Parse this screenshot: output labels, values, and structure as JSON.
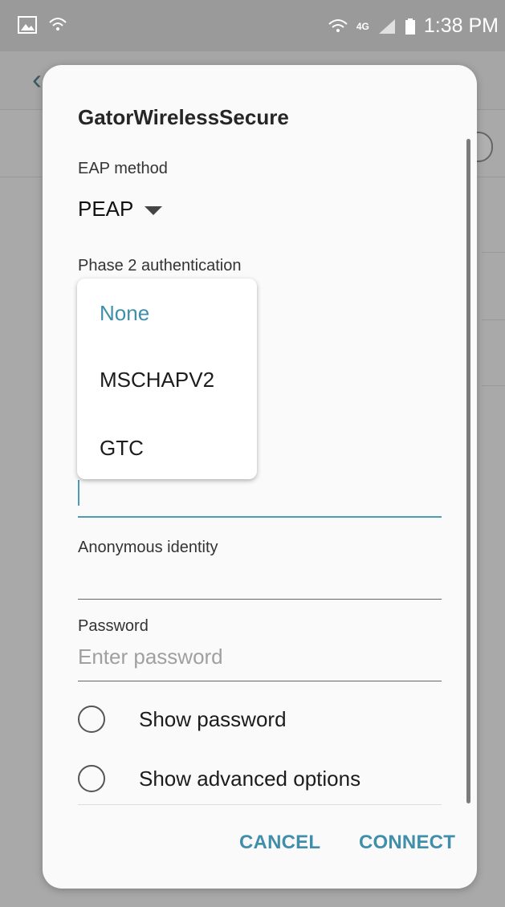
{
  "status_bar": {
    "network_badge": "4G",
    "time": "1:38 PM",
    "icons": [
      "gallery-icon",
      "wifi-icon",
      "wifi-calling-icon",
      "signal-icon",
      "battery-icon"
    ]
  },
  "dialog": {
    "title": "GatorWirelessSecure",
    "eap_method": {
      "label": "EAP method",
      "value": "PEAP"
    },
    "phase2": {
      "label": "Phase 2 authentication",
      "options": [
        {
          "label": "None",
          "selected": true
        },
        {
          "label": "MSCHAPV2",
          "selected": false
        },
        {
          "label": "GTC",
          "selected": false
        }
      ]
    },
    "anonymous_identity": {
      "label": "Anonymous identity",
      "value": ""
    },
    "password": {
      "label": "Password",
      "placeholder": "Enter password"
    },
    "checkboxes": [
      {
        "label": "Show password",
        "checked": false
      },
      {
        "label": "Show advanced options",
        "checked": false
      }
    ],
    "buttons": {
      "cancel": "CANCEL",
      "connect": "CONNECT"
    }
  },
  "colors": {
    "accent": "#3f8eaa",
    "scrim": "#9a9a9a",
    "dialog_bg": "#fafafa"
  }
}
